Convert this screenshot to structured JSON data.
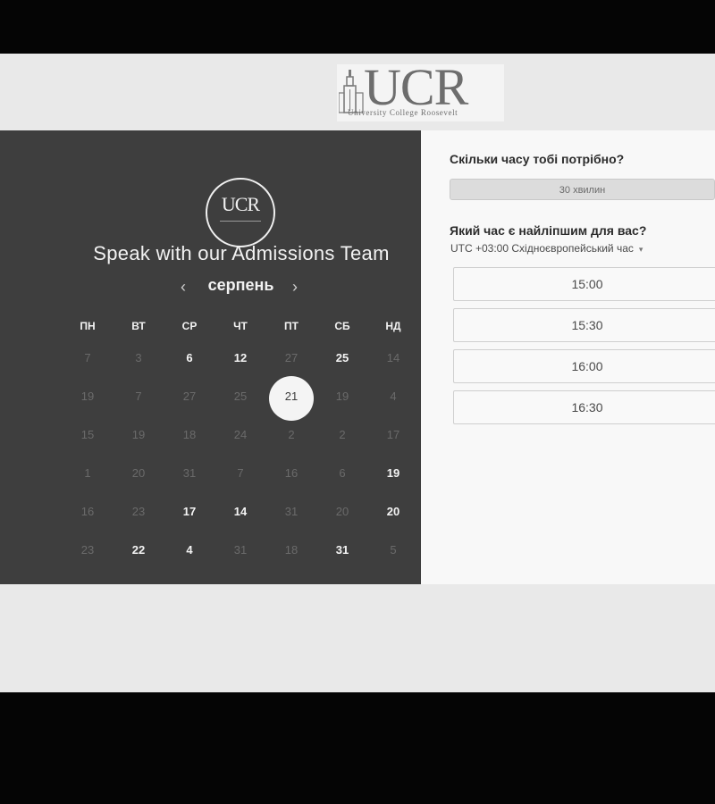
{
  "logo": {
    "text": "UCR",
    "subtitle": "University College Roosevelt"
  },
  "left": {
    "badge_text": "UCR",
    "headline": "Speak with our Admissions Team",
    "month": "серпень",
    "prev_icon": "‹",
    "next_icon": "›",
    "weekdays": [
      "ПН",
      "ВТ",
      "СР",
      "ЧТ",
      "ПТ",
      "СБ",
      "НД"
    ],
    "weeks": [
      [
        {
          "d": "7",
          "s": "disabled"
        },
        {
          "d": "3",
          "s": "disabled"
        },
        {
          "d": "6",
          "s": "available"
        },
        {
          "d": "12",
          "s": "available"
        },
        {
          "d": "27",
          "s": "disabled"
        },
        {
          "d": "25",
          "s": "available"
        },
        {
          "d": "14",
          "s": "disabled"
        }
      ],
      [
        {
          "d": "19",
          "s": "disabled"
        },
        {
          "d": "7",
          "s": "disabled"
        },
        {
          "d": "27",
          "s": "disabled"
        },
        {
          "d": "25",
          "s": "disabled"
        },
        {
          "d": "21",
          "s": "selected"
        },
        {
          "d": "19",
          "s": "disabled"
        },
        {
          "d": "4",
          "s": "disabled"
        }
      ],
      [
        {
          "d": "15",
          "s": "disabled"
        },
        {
          "d": "19",
          "s": "disabled"
        },
        {
          "d": "18",
          "s": "disabled"
        },
        {
          "d": "24",
          "s": "disabled"
        },
        {
          "d": "2",
          "s": "disabled"
        },
        {
          "d": "2",
          "s": "disabled"
        },
        {
          "d": "17",
          "s": "disabled"
        }
      ],
      [
        {
          "d": "1",
          "s": "disabled"
        },
        {
          "d": "20",
          "s": "disabled"
        },
        {
          "d": "31",
          "s": "disabled"
        },
        {
          "d": "7",
          "s": "disabled"
        },
        {
          "d": "16",
          "s": "disabled"
        },
        {
          "d": "6",
          "s": "disabled"
        },
        {
          "d": "19",
          "s": "available"
        }
      ],
      [
        {
          "d": "16",
          "s": "disabled"
        },
        {
          "d": "23",
          "s": "disabled"
        },
        {
          "d": "17",
          "s": "available"
        },
        {
          "d": "14",
          "s": "available"
        },
        {
          "d": "31",
          "s": "disabled"
        },
        {
          "d": "20",
          "s": "disabled"
        },
        {
          "d": "20",
          "s": "available"
        }
      ],
      [
        {
          "d": "23",
          "s": "disabled"
        },
        {
          "d": "22",
          "s": "available"
        },
        {
          "d": "4",
          "s": "available"
        },
        {
          "d": "31",
          "s": "disabled"
        },
        {
          "d": "18",
          "s": "disabled"
        },
        {
          "d": "31",
          "s": "available"
        },
        {
          "d": "5",
          "s": "disabled"
        }
      ]
    ]
  },
  "right": {
    "duration_question": "Скільки часу тобі потрібно?",
    "duration_value": "30 хвилин",
    "time_question": "Який час є найліпшим для вас?",
    "timezone": "UTC +03:00 Східноєвропейський час",
    "timezone_caret": "▾",
    "slots": [
      "15:00",
      "15:30",
      "16:00",
      "16:30"
    ]
  }
}
